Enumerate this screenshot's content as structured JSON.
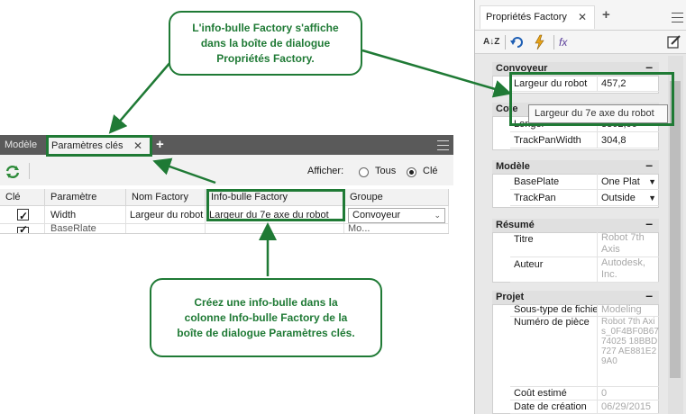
{
  "callouts": {
    "top": {
      "line1": "L'info-bulle Factory s'affiche",
      "line2": "dans la boîte de dialogue",
      "line3": "Propriétés Factory."
    },
    "bottom": {
      "line1": "Créez une info-bulle dans la",
      "line2": "colonne Info-bulle Factory de la",
      "line3": "boîte de dialogue Paramètres clés."
    }
  },
  "left_panel": {
    "tabs": {
      "model": "Modèle",
      "params": "Paramètres clés",
      "close": "✕",
      "plus": "+"
    },
    "toolbar": {
      "afficher": "Afficher:",
      "tous": "Tous",
      "cle": "Clé",
      "selected": "Clé"
    },
    "columns": [
      "Clé",
      "Paramètre",
      "Nom Factory",
      "Info-bulle Factory",
      "Groupe"
    ],
    "rows": [
      {
        "key": true,
        "param": "Width",
        "factory_name": "Largeur du robot",
        "tooltip": "Largeur du 7e axe du robot",
        "group": "Convoyeur"
      },
      {
        "key": true,
        "param": "BaseRlate",
        "factory_name": "",
        "tooltip": "",
        "group": "Mo..."
      }
    ]
  },
  "right_panel": {
    "tab": "Propriétés Factory",
    "tab_close": "✕",
    "plus": "+",
    "toolbar_icons": [
      "sort-az-icon",
      "undo-icon",
      "lightning-icon",
      "formula-icon",
      "edit-icon"
    ],
    "sections": {
      "convoyeur": {
        "title": "Convoyeur",
        "rows": [
          {
            "label": "Largeur du robot",
            "value": "457,2"
          }
        ]
      },
      "cote": {
        "title": "Cote",
        "rows": [
          {
            "label": "Longer",
            "value": "3302,06"
          },
          {
            "label": "TrackPanWidth",
            "value": "304,8"
          }
        ]
      },
      "modele": {
        "title": "Modèle",
        "rows": [
          {
            "label": "BasePlate",
            "value": "One Plat"
          },
          {
            "label": "TrackPan",
            "value": "Outside"
          }
        ]
      },
      "resume": {
        "title": "Résumé",
        "rows": [
          {
            "label": "Titre",
            "value": "Robot 7th Axis"
          },
          {
            "label": "Auteur",
            "value": "Autodesk, Inc."
          }
        ]
      },
      "projet": {
        "title": "Projet",
        "rows": [
          {
            "label": "Sous-type de fichie",
            "value": "Modeling"
          },
          {
            "label": "Numéro de pièce",
            "value": "Robot 7th Axis_0F4BF0B6774025 18BBD727 AE881E29A0"
          },
          {
            "label": "Coût estimé",
            "value": "0"
          },
          {
            "label": "Date de création",
            "value": "06/29/2015"
          }
        ]
      }
    },
    "tooltip": "Largeur du 7e axe du robot",
    "collapse": "–"
  },
  "colors": {
    "callout": "#1f7a35",
    "tabbar": "#5a5a5a"
  }
}
